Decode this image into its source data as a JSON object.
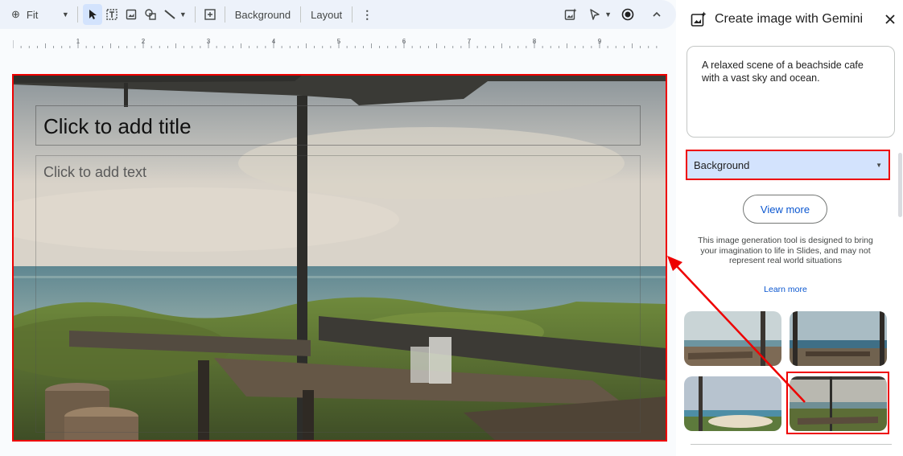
{
  "toolbar": {
    "zoom_label": "Fit",
    "background_label": "Background",
    "layout_label": "Layout"
  },
  "ruler": {
    "numbers": [
      "1",
      "2",
      "3",
      "4",
      "5",
      "6",
      "7",
      "8",
      "9"
    ]
  },
  "slide": {
    "title_placeholder": "Click to add title",
    "body_placeholder": "Click to add text"
  },
  "panel": {
    "title": "Create image with Gemini",
    "prompt_text": "A relaxed scene of a beachside cafe with a vast sky and ocean.",
    "style_value": "Background",
    "view_more_label": "View more",
    "disclaimer": "This image generation tool is designed to bring your imagination to life in Slides, and may not represent real world situations",
    "learn_more_label": "Learn more"
  },
  "colors": {
    "accent_blue": "#0b57d0",
    "selection_blue": "#d3e3fd",
    "annotation_red": "#e00000"
  },
  "icons": [
    "zoom-icon",
    "dropdown-arrow-icon",
    "select-cursor-icon",
    "text-box-icon",
    "image-icon",
    "shapes-icon",
    "line-icon",
    "add-comment-icon",
    "more-vert-icon",
    "gemini-image-icon",
    "pointer-icon",
    "record-icon",
    "collapse-icon",
    "close-icon"
  ]
}
